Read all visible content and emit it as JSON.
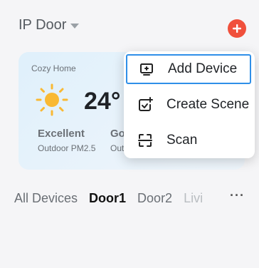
{
  "header": {
    "home_name": "IP Door",
    "add_icon": "plus-icon",
    "accent": "#f0503c"
  },
  "weather_card": {
    "home_label": "Cozy Home",
    "temperature": "24°",
    "air_quality": "Excellent",
    "air_quality_sub": "Outdoor PM2.5",
    "second_label": "Go",
    "second_sub": "Out",
    "weather_icon": "sun-icon"
  },
  "tabs": [
    "All Devices",
    "Door1",
    "Door2",
    "Livi"
  ],
  "active_tab": "Door1",
  "more_label": "···",
  "popup_menu": {
    "items": [
      {
        "label": "Add Device",
        "icon": "add-device-icon"
      },
      {
        "label": "Create Scene",
        "icon": "create-scene-icon"
      },
      {
        "label": "Scan",
        "icon": "scan-icon"
      }
    ],
    "highlight_color": "#2f8fe8"
  }
}
